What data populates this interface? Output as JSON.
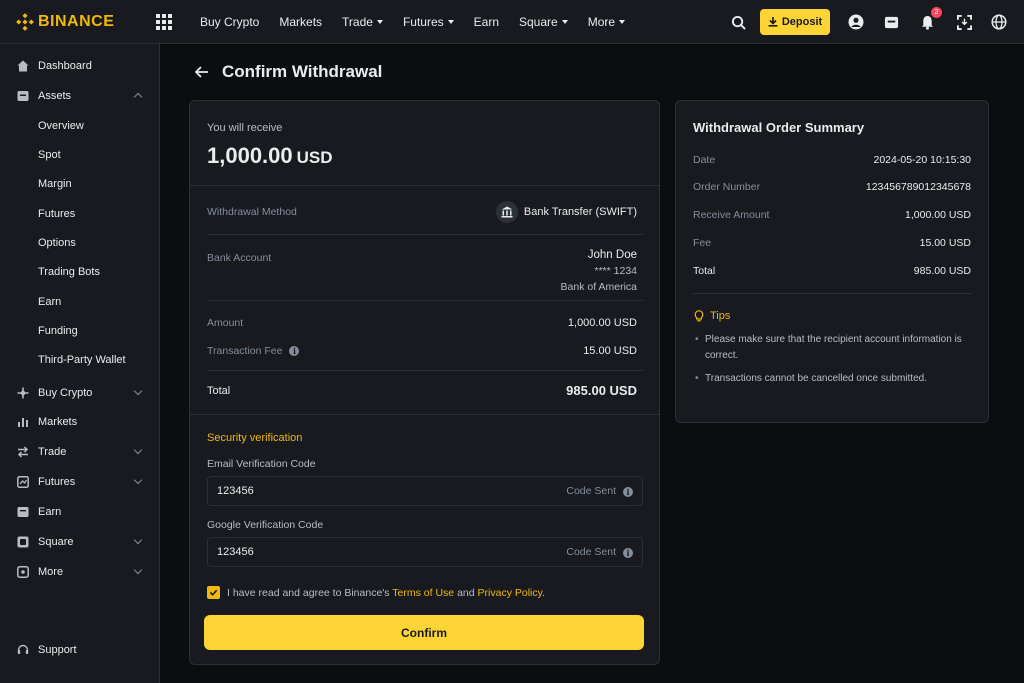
{
  "brand": {
    "name": "BINANCE",
    "accent": "#f0b90b"
  },
  "topnav": {
    "items": [
      {
        "label": "Buy Crypto",
        "has_caret": false
      },
      {
        "label": "Markets",
        "has_caret": false
      },
      {
        "label": "Trade",
        "has_caret": true
      },
      {
        "label": "Futures",
        "has_caret": true
      },
      {
        "label": "Earn",
        "has_caret": false
      },
      {
        "label": "Square",
        "has_caret": true
      },
      {
        "label": "More",
        "has_caret": true
      }
    ],
    "deposit_label": "Deposit",
    "notification_count": "2",
    "icons": [
      "search-icon",
      "user-icon",
      "wallet-icon",
      "bell-icon",
      "download-icon",
      "globe-icon"
    ]
  },
  "sidebar": {
    "dashboard": "Dashboard",
    "assets": "Assets",
    "assets_sub": [
      "Overview",
      "Spot",
      "Margin",
      "Futures",
      "Options",
      "Trading Bots",
      "Earn",
      "Funding",
      "Third-Party Wallet"
    ],
    "buy_crypto": "Buy Crypto",
    "markets": "Markets",
    "trade": "Trade",
    "futures": "Futures",
    "earn": "Earn",
    "square": "Square",
    "more": "More",
    "support": "Support"
  },
  "page": {
    "title": "Confirm Withdrawal"
  },
  "withdrawal": {
    "receive_label": "You will receive",
    "receive_amount": "1,000.00",
    "receive_currency": "USD",
    "method_label": "Withdrawal Method",
    "method_value": "Bank Transfer (SWIFT)",
    "account_label": "Bank Account",
    "account_name": "John Doe",
    "account_number": "**** 1234",
    "account_bank": "Bank of America",
    "amount_label": "Amount",
    "amount_value": "1,000.00 USD",
    "fee_label": "Transaction Fee",
    "fee_value": "15.00 USD",
    "total_label": "Total",
    "total_value": "985.00 USD"
  },
  "security": {
    "title": "Security verification",
    "email_label": "Email Verification Code",
    "email_value": "123456",
    "email_status": "Code Sent",
    "google_label": "Google Verification Code",
    "google_value": "123456",
    "google_status": "Code Sent",
    "agree_prefix": "I have read and agree to Binance's",
    "terms_link": "Terms of Use",
    "agree_and": "and",
    "privacy_link": "Privacy Policy",
    "agree_suffix": ".",
    "agree_checked": true,
    "confirm_label": "Confirm"
  },
  "summary": {
    "title": "Withdrawal Order Summary",
    "rows": [
      {
        "label": "Date",
        "value": "2024-05-20 10:15:30"
      },
      {
        "label": "Order Number",
        "value": "123456789012345678"
      },
      {
        "label": "Receive Amount",
        "value": "1,000.00 USD"
      },
      {
        "label": "Fee",
        "value": "15.00 USD"
      },
      {
        "label": "Total",
        "value": "985.00 USD"
      }
    ],
    "tips_title": "Tips",
    "tips": [
      "Please make sure that the recipient account information is correct.",
      "Transactions cannot be cancelled once submitted."
    ]
  }
}
